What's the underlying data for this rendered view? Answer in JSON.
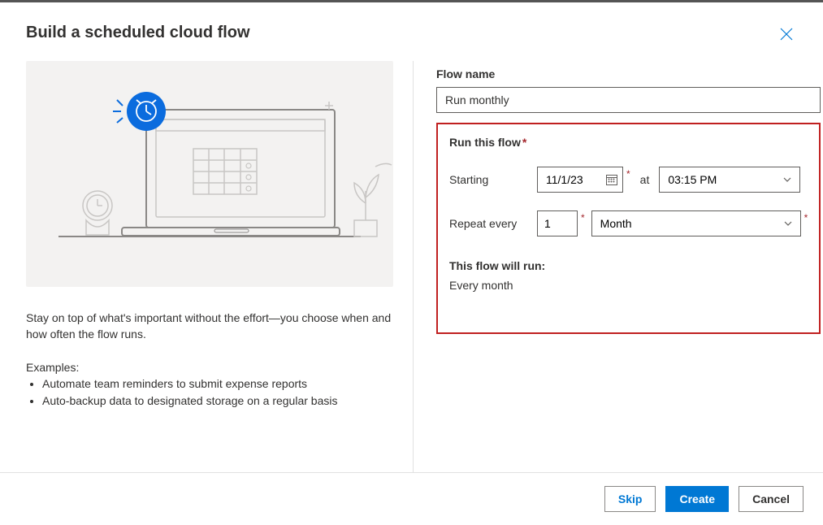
{
  "dialog": {
    "title": "Build a scheduled cloud flow"
  },
  "left": {
    "description": "Stay on top of what's important without the effort—you choose when and how often the flow runs.",
    "examples_heading": "Examples:",
    "examples": [
      "Automate team reminders to submit expense reports",
      "Auto-backup data to designated storage on a regular basis"
    ]
  },
  "form": {
    "flow_name_label": "Flow name",
    "flow_name_value": "Run monthly",
    "run_this_flow_label": "Run this flow",
    "starting_label": "Starting",
    "starting_date": "11/1/23",
    "at_label": "at",
    "starting_time": "03:15 PM",
    "repeat_label": "Repeat every",
    "repeat_count": "1",
    "repeat_unit": "Month",
    "summary_heading": "This flow will run:",
    "summary_text": "Every month"
  },
  "footer": {
    "skip": "Skip",
    "create": "Create",
    "cancel": "Cancel"
  }
}
